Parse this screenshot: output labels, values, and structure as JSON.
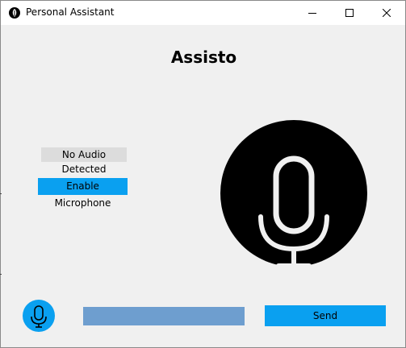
{
  "window": {
    "title": "Personal Assistant",
    "icon": "app-feather-icon",
    "controls": [
      "minimize-icon",
      "maximize-icon",
      "close-icon"
    ]
  },
  "app": {
    "title": "Assisto"
  },
  "status": {
    "text": "No Audio Detected"
  },
  "buttons": {
    "enable_microphone": "Enable Microphone",
    "send": "Send",
    "mic_icon": "microphone-icon"
  },
  "input": {
    "value": "",
    "placeholder": ""
  },
  "colors": {
    "accent": "#0aa0f0",
    "input_bg": "#6e9ecf",
    "background": "#f0f0f0",
    "status_bg": "#dcdcdc",
    "mic_circle": "#000000"
  }
}
